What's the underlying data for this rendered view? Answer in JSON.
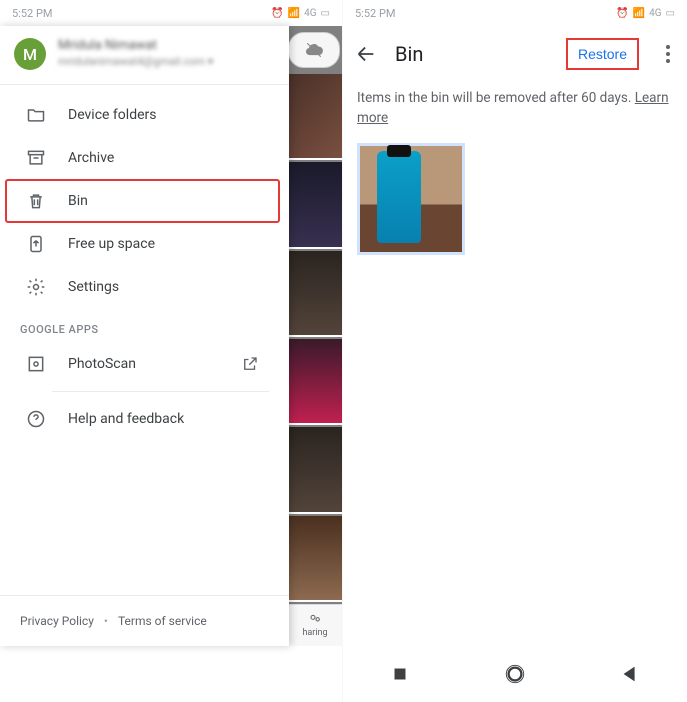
{
  "status": {
    "time": "5:52 PM",
    "network": "4G"
  },
  "left": {
    "profile": {
      "initial": "M",
      "name": "Mridula Nimawat",
      "email": "mridulanimawat4@gmail.com"
    },
    "items": [
      {
        "label": "Device folders",
        "icon": "folder"
      },
      {
        "label": "Archive",
        "icon": "archive"
      },
      {
        "label": "Bin",
        "icon": "trash",
        "highlighted": true
      },
      {
        "label": "Free up space",
        "icon": "broom"
      },
      {
        "label": "Settings",
        "icon": "gear"
      }
    ],
    "section": "GOOGLE APPS",
    "apps": [
      {
        "label": "PhotoScan",
        "icon": "photoscan",
        "external": true
      }
    ],
    "help": {
      "label": "Help and feedback"
    },
    "footer": {
      "privacy": "Privacy Policy",
      "terms": "Terms of service"
    },
    "backdrop_chip": "haring"
  },
  "right": {
    "title": "Bin",
    "restore": "Restore",
    "notice_pre": "Items in the bin will be removed after 60 days. ",
    "notice_link": "Learn more"
  }
}
